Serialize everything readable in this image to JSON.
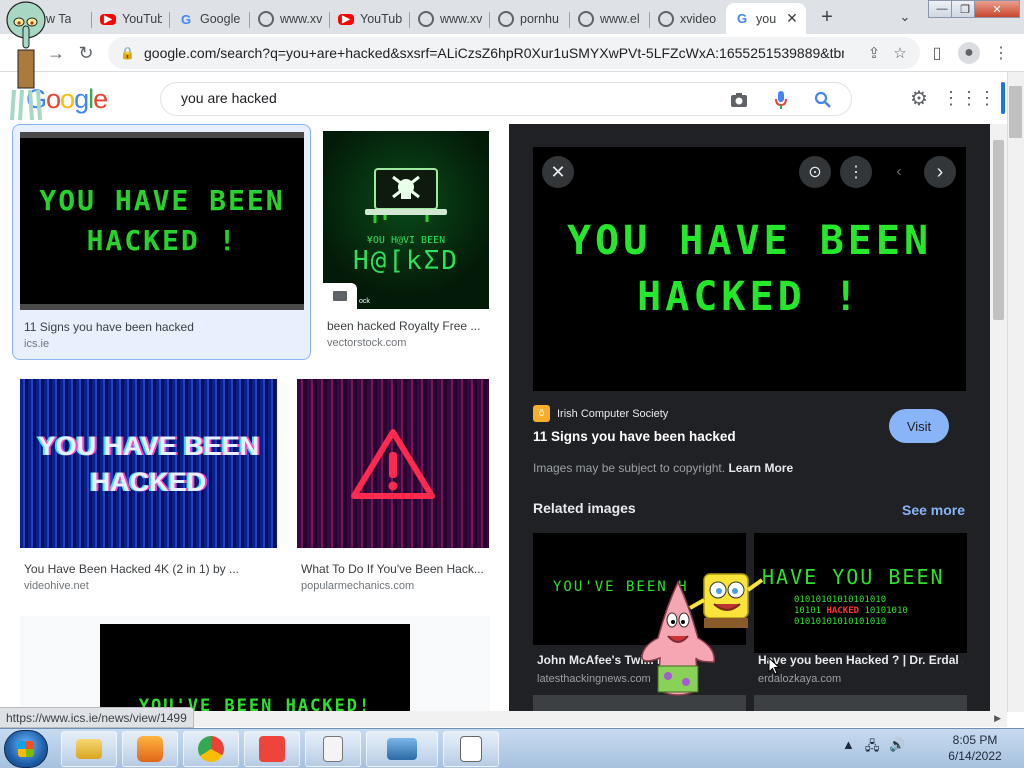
{
  "tabs": [
    {
      "title": "New Ta",
      "icon": "blank-tab-icon"
    },
    {
      "title": "YouTub",
      "icon": "youtube-icon"
    },
    {
      "title": "Google",
      "icon": "google-icon"
    },
    {
      "title": "www.xv",
      "icon": "globe-icon"
    },
    {
      "title": "YouTub",
      "icon": "youtube-icon"
    },
    {
      "title": "www.xv",
      "icon": "globe-icon"
    },
    {
      "title": "pornhu",
      "icon": "globe-icon"
    },
    {
      "title": "www.el",
      "icon": "globe-icon"
    },
    {
      "title": "xvideo",
      "icon": "globe-icon"
    },
    {
      "title": "you",
      "icon": "google-icon",
      "active": true
    }
  ],
  "toolbar": {
    "url": "google.com/search?q=you+are+hacked&sxsrf=ALiCzsZ6hpR0Xur1uSMYXwPVt-5LFZcWxA:1655251539889&tbm..."
  },
  "google": {
    "logo": "Google",
    "query": "you are hacked"
  },
  "results": [
    {
      "caption": "11 Signs you have been hacked",
      "source": "ics.ie",
      "thumb_text": [
        "YOU HAVE BEEN",
        "HACKED !"
      ]
    },
    {
      "caption": "been hacked Royalty Free ...",
      "source": "vectorstock.com",
      "thumb_text": [
        "¥OU H@VI BEEN",
        "H@[kΣD"
      ],
      "badge": "ock"
    },
    {
      "caption": "You Have Been Hacked 4K (2 in 1) by ...",
      "source": "videohive.net",
      "thumb_text": [
        "YOU HAVE BEEN",
        "HACKED"
      ]
    },
    {
      "caption": "What To Do If You've Been Hack...",
      "source": "popularmechanics.com",
      "thumb_text": [
        "!"
      ]
    },
    {
      "caption": "",
      "source": "",
      "thumb_text": [
        "YOU'VE BEEN HACKED!"
      ]
    }
  ],
  "preview": {
    "image_text": [
      "YOU HAVE BEEN",
      "HACKED !"
    ],
    "site": "Irish Computer Society",
    "title": "11 Signs you have been hacked",
    "visit": "Visit",
    "copyright": "Images may be subject to copyright.",
    "learn_more": "Learn More",
    "related_heading": "Related images",
    "see_more": "See more",
    "related": [
      {
        "title": "John McAfee's Twi... Hac...",
        "source": "latesthackingnews.com",
        "img_text": "YOU'VE BEEN H"
      },
      {
        "title": "Have you been Hacked ? | Dr. Erdal ...",
        "source": "erdalozkaya.com",
        "img_text": "HAVE YOU BEEN",
        "img_sub": "HACKED"
      }
    ]
  },
  "status_url": "https://www.ics.ie/news/view/1499",
  "clock": {
    "time": "8:05 PM",
    "date": "6/14/2022"
  },
  "colors": {
    "accent": "#8ab4f8",
    "hacker_green": "#25e82a",
    "panel": "#202124"
  }
}
